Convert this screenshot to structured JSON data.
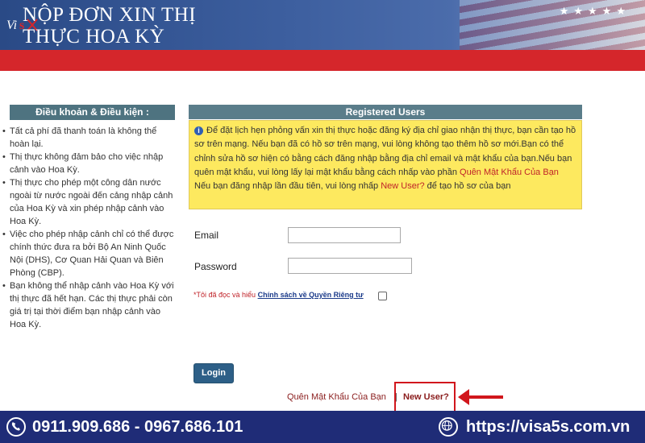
{
  "header": {
    "title_line1": "NỘP ĐƠN XIN THỊ",
    "title_line2": "THỰC HOA KỲ",
    "logo_icon": "visa5s-logo-icon"
  },
  "terms": {
    "heading": "Điều khoản & Điều kiện :",
    "items": [
      "Tất cả phí đã thanh toán là không thể hoàn lại.",
      "Thị thực không đảm bảo cho việc nhập cảnh vào Hoa Kỳ.",
      "Thị thực cho phép một công dân nước ngoài từ nước ngoài đến cảng nhập cảnh của Hoa Kỳ và xin phép nhập cảnh vào Hoa Kỳ.",
      "Việc cho phép nhập cảnh chỉ có thể được chính thức đưa ra bởi Bộ An Ninh Quốc Nội (DHS), Cơ Quan Hải Quan và Biên Phòng (CBP).",
      "Bạn không thể nhập cảnh vào Hoa Kỳ với thị thực đã hết hạn. Các thị thực phải còn giá trị tại thời điểm bạn nhập cảnh vào Hoa Kỳ."
    ]
  },
  "panel": {
    "heading": "Registered Users",
    "notice_part1": "Để đặt lịch hẹn phỏng vấn xin thị thực hoặc đăng ký địa chỉ giao nhận thị thực, bạn cần tạo hồ sơ trên mạng. Nếu bạn đã có hồ sơ trên mạng, vui lòng không tạo thêm hồ sơ mới.Bạn có thể chỉnh sửa hồ sơ hiện có bằng cách đăng nhập bằng địa chỉ email và mật khẩu của bạn.Nếu bạn quên mật khẩu, vui lòng lấy lại mật khẩu bằng cách nhấp vào phần",
    "notice_forgot": "Quên Mật Khẩu Của Bạn",
    "notice_part2": "Nếu bạn đăng nhập lần đầu tiên, vui lòng nhấp",
    "notice_newuser": "New User?",
    "notice_part3": "để tạo hồ sơ của bạn",
    "info_icon": "info-icon"
  },
  "form": {
    "email_label": "Email",
    "email_value": "",
    "password_label": "Password",
    "password_value": "",
    "privacy_required": "*Tôi đã đọc và hiểu",
    "privacy_policy": "Chính sách về Quyền Riêng tư",
    "privacy_checked": false,
    "login_label": "Login"
  },
  "links": {
    "forgot": "Quên Mật Khẩu Của Bạn",
    "separator": "|",
    "new_user": "New User?"
  },
  "footer": {
    "phones": "0911.909.686 - 0967.686.101",
    "url": "https://visa5s.com.vn",
    "phone_icon": "phone-icon",
    "globe_icon": "globe-icon"
  },
  "colors": {
    "header_blue": "#2a4a86",
    "red_bar": "#d5262b",
    "notice_yellow": "#fde95f",
    "panel_heading": "#5a7d8a",
    "login_button": "#2d5f87",
    "footer_navy": "#1f2c77"
  }
}
